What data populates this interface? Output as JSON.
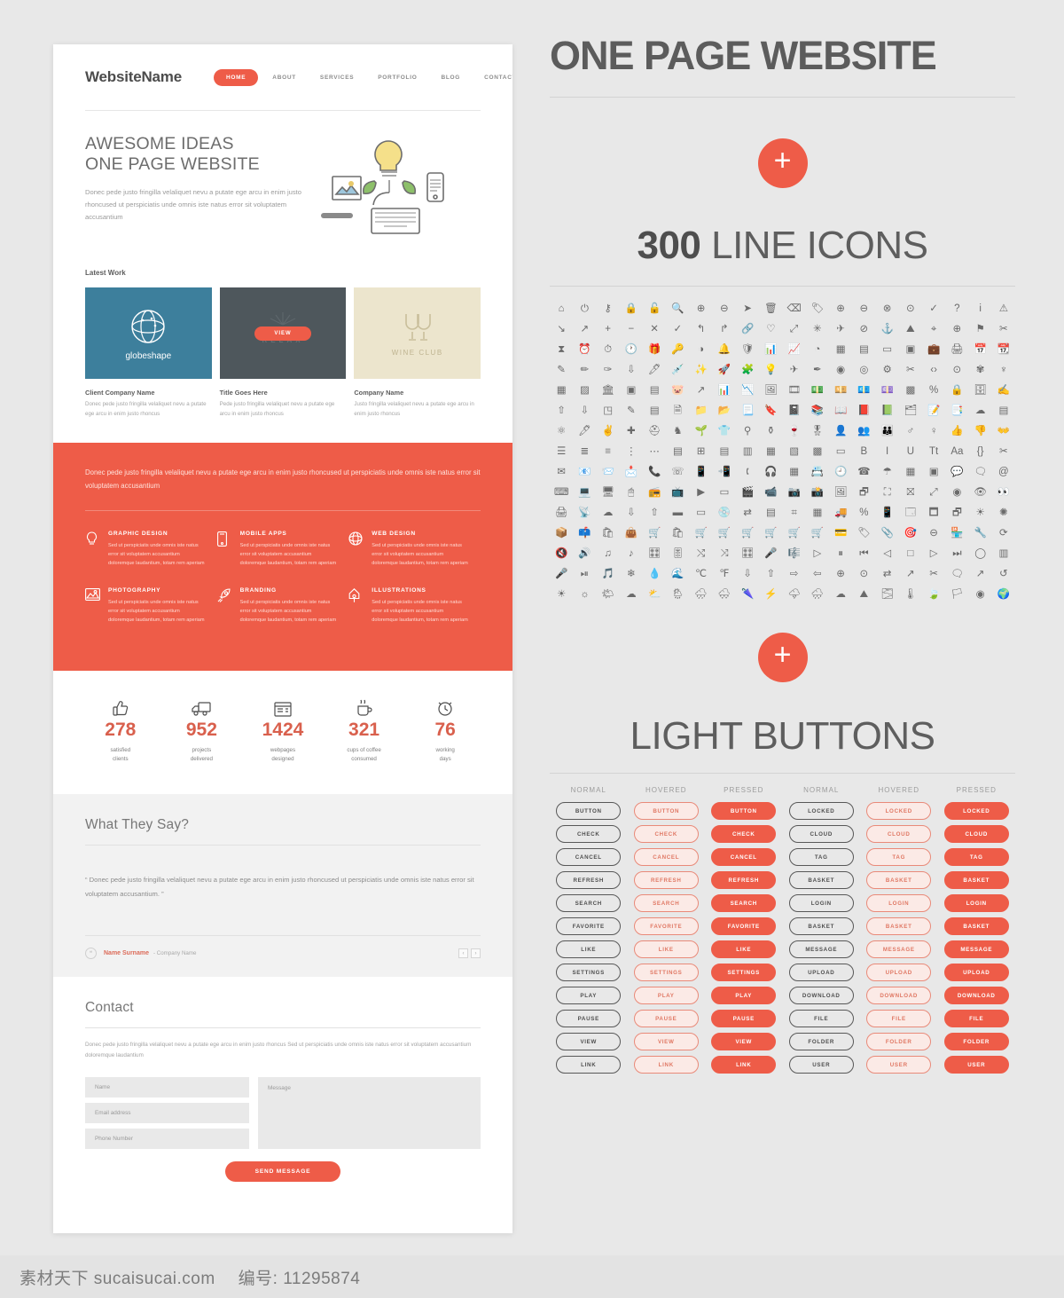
{
  "site": {
    "logo": "WebsiteName",
    "nav": [
      {
        "label": "HOME",
        "active": true
      },
      {
        "label": "ABOUT",
        "active": false
      },
      {
        "label": "SERVICES",
        "active": false
      },
      {
        "label": "PORTFOLIO",
        "active": false
      },
      {
        "label": "BLOG",
        "active": false
      },
      {
        "label": "CONTACT",
        "active": false
      }
    ],
    "hero": {
      "title_line1": "AWESOME IDEAS",
      "title_line2": "ONE PAGE WEBSITE",
      "paragraph": "Donec pede justo fringilla velaliquet nevu a putate ege arcu in enim justo rhoncused ut perspiciatis unde omnis iste natus error sit voluptatem accusantium"
    },
    "latest_work": {
      "label": "Latest Work",
      "items": [
        {
          "brand": "globeshape",
          "bg": "#3d7f9c",
          "title": "Client Company Name",
          "desc": "Donec pede justo fringilla velaliquet nevu a putate ege arcu in enim justo rhoncus"
        },
        {
          "brand": "RELAX",
          "button": "VIEW",
          "bg": "#4e575c",
          "title": "Title Goes Here",
          "desc": "Pede justo fringilla velaliquet nevu a putate ege arcu in enim justo rhoncus"
        },
        {
          "brand": "WINE CLUB",
          "bg": "#ece5cd",
          "title": "Company Name",
          "desc": "Justo fringilla velaliquet nevu a putate ege arcu in enim justo rhoncus"
        }
      ]
    },
    "services": {
      "intro": "Donec pede justo fringilla velaliquet nevu a putate ege arcu in enim justo rhoncused ut perspiciatis unde omnis iste natus error sit voluptatem accusantium",
      "items": [
        {
          "icon": "lightbulb-icon",
          "title": "GRAPHIC DESIGN",
          "desc": "Sed ut perspiciatis unde omnis iste natus error sit voluptatem accusantium doloremque laudantium, totam rem aperiam"
        },
        {
          "icon": "mobile-phone-icon",
          "title": "MOBILE APPS",
          "desc": "Sed ut perspiciatis unde omnis iste natus error sit voluptatem accusantium doloremque laudantium, totam rem aperiam"
        },
        {
          "icon": "globe-icon",
          "title": "WEB DESIGN",
          "desc": "Sed ut perspiciatis unde omnis iste natus error sit voluptatem accusantium doloremque laudantium, totam rem aperiam"
        },
        {
          "icon": "photo-icon",
          "title": "PHOTOGRAPHY",
          "desc": "Sed ut perspiciatis unde omnis iste natus error sit voluptatem accusantium doloremque laudantium, totam rem aperiam"
        },
        {
          "icon": "rocket-icon",
          "title": "BRANDING",
          "desc": "Sed ut perspiciatis unde omnis iste natus error sit voluptatem accusantium doloremque laudantium, totam rem aperiam"
        },
        {
          "icon": "pen-nib-icon",
          "title": "ILLUSTRATIONS",
          "desc": "Sed ut perspiciatis unde omnis iste natus error sit voluptatem accusantium doloremque laudantium, totam rem aperiam"
        }
      ]
    },
    "stats": [
      {
        "icon": "thumbs-up-icon",
        "value": "278",
        "label_line1": "satisfied",
        "label_line2": "clients"
      },
      {
        "icon": "delivery-truck-icon",
        "value": "952",
        "label_line1": "projects",
        "label_line2": "delivered"
      },
      {
        "icon": "browser-window-icon",
        "value": "1424",
        "label_line1": "webpages",
        "label_line2": "designed"
      },
      {
        "icon": "coffee-cup-icon",
        "value": "321",
        "label_line1": "cups of coffee",
        "label_line2": "consumed"
      },
      {
        "icon": "alarm-clock-icon",
        "value": "76",
        "label_line1": "working",
        "label_line2": "days"
      }
    ],
    "testimonial": {
      "heading": "What They Say?",
      "quote": "“ Donec pede justo fringilla velaliquet nevu a putate ege arcu in enim justo rhoncused ut perspiciatis unde omnis iste natus error sit voluptatem accusantium. ”",
      "author": "Name Surname",
      "company": "- Company Name",
      "prev": "‹",
      "next": "›"
    },
    "contact": {
      "heading": "Contact",
      "paragraph": "Donec pede justo fringilla velaliquet nevu a putate ege arcu in enim justo rhoncus Sed ut perspiciatis unde omnis iste natus error sit voluptatem accusantium doloremque laudantium",
      "name_placeholder": "Name",
      "email_placeholder": "Email address",
      "phone_placeholder": "Phone Number",
      "message_placeholder": "Message",
      "send_label": "SEND MESSAGE"
    }
  },
  "right": {
    "title": "ONE PAGE WEBSITE",
    "plus_label": "+",
    "icons_count": "300",
    "icons_title": " LINE ICONS",
    "buttons_title": "LIGHT BUTTONS",
    "state_headers": [
      "NORMAL",
      "HOVERED",
      "PRESSED",
      "NORMAL",
      "HOVERED",
      "PRESSED"
    ],
    "buttons_left": [
      "BUTTON",
      "CHECK",
      "CANCEL",
      "REFRESH",
      "SEARCH",
      "FAVORITE",
      "LIKE",
      "SETTINGS",
      "PLAY",
      "PAUSE",
      "VIEW",
      "LINK"
    ],
    "buttons_right": [
      "LOCKED",
      "CLOUD",
      "TAG",
      "BASKET",
      "LOGIN",
      "BASKET",
      "MESSAGE",
      "UPLOAD",
      "DOWNLOAD",
      "FILE",
      "FOLDER",
      "USER"
    ],
    "icon_glyphs": [
      "⌂",
      "⏻",
      "⚷",
      "🔒",
      "🔓",
      "🔍",
      "⊕",
      "⊖",
      "➤",
      "🗑",
      "⌫",
      "🏷",
      "⊕",
      "⊖",
      "⊗",
      "⊙",
      "✓",
      "?",
      "i",
      "⚠",
      "↘",
      "↗",
      "+",
      "−",
      "✕",
      "✓",
      "↰",
      "↱",
      "🔗",
      "♡",
      "⤢",
      "✳",
      "✈",
      "⊘",
      "⚓",
      "⛰",
      "⌖",
      "⊕",
      "⚑",
      "✂",
      "⧗",
      "⏰",
      "⏱",
      "🕐",
      "🎁",
      "🔑",
      "◑",
      "🔔",
      "🛡",
      "📊",
      "📈",
      "◔",
      "▦",
      "▤",
      "▭",
      "▣",
      "💼",
      "🖨",
      "📅",
      "📆",
      "✎",
      "✏",
      "✑",
      "⇩",
      "🖊",
      "💉",
      "✨",
      "🚀",
      "🧩",
      "💡",
      "✈",
      "✒",
      "◉",
      "◎",
      "⚙",
      "✂",
      "‹›",
      "⊙",
      "✾",
      "♆",
      "▦",
      "▨",
      "🏛",
      "▣",
      "▤",
      "🐷",
      "↗",
      "📊",
      "📉",
      "🖼",
      "🎞",
      "💵",
      "💴",
      "💶",
      "💷",
      "▩",
      "%",
      "🔒",
      "🗄",
      "✍",
      "⇧",
      "⇩",
      "◳",
      "✎",
      "▤",
      "🗎",
      "📁",
      "📂",
      "📃",
      "🔖",
      "📓",
      "📚",
      "📖",
      "📕",
      "📗",
      "🗂",
      "📝",
      "📑",
      "☁",
      "▤",
      "⚛",
      "🖊",
      "✌",
      "✚",
      "⛑",
      "♞",
      "🌱",
      "👕",
      "⚲",
      "⚱",
      "🍷",
      "🎖",
      "👤",
      "👥",
      "👪",
      "♂",
      "♀",
      "👍",
      "👎",
      "👐",
      "☰",
      "≣",
      "≡",
      "⋮",
      "⋯",
      "▤",
      "⊞",
      "▤",
      "▥",
      "▦",
      "▧",
      "▩",
      "▭",
      "B",
      "I",
      "U",
      "Tt",
      "Aa",
      "{}",
      "✂",
      "✉",
      "📧",
      "📨",
      "📩",
      "📞",
      "☏",
      "📱",
      "📲",
      "🕻",
      "🎧",
      "▦",
      "📇",
      "🕘",
      "☎",
      "☂",
      "▦",
      "▣",
      "💬",
      "🗨",
      "@",
      "⌨",
      "💻",
      "🖥",
      "🖱",
      "📻",
      "📺",
      "▶",
      "▭",
      "🎬",
      "📹",
      "📷",
      "📸",
      "🖼",
      "🗗",
      "⛶",
      "⛝",
      "⤢",
      "◉",
      "👁",
      "👀",
      "🖨",
      "📡",
      "☁",
      "⇩",
      "⇧",
      "▬",
      "▭",
      "💿",
      "⇄",
      "▤",
      "⌗",
      "▦",
      "🚚",
      "%",
      "📱",
      "🗔",
      "🗖",
      "🗗",
      "☀",
      "✺",
      "📦",
      "📫",
      "🛍",
      "👜",
      "🛒",
      "🛍",
      "🛒",
      "🛒",
      "🛒",
      "🛒",
      "🛒",
      "🛒",
      "💳",
      "🏷",
      "📎",
      "🎯",
      "⊖",
      "🏪",
      "🔧",
      "⟳",
      "🔇",
      "🔊",
      "♫",
      "♪",
      "🎛",
      "🎚",
      "⤭",
      "⤨",
      "🎛",
      "🎤",
      "🎼",
      "▷",
      "⏸",
      "⏮",
      "◁",
      "□",
      "▷",
      "⏭",
      "◯",
      "▥",
      "🎤",
      "⏯",
      "🎵",
      "❄",
      "💧",
      "🌊",
      "℃",
      "℉",
      "⇩",
      "⇧",
      "⇨",
      "⇦",
      "⊕",
      "⊙",
      "⇄",
      "↗",
      "✂",
      "🗨",
      "↗",
      "↺",
      "☀",
      "☼",
      "🌤",
      "☁",
      "⛅",
      "🌦",
      "🌧",
      "🌨",
      "🌂",
      "⚡",
      "🌩",
      "🌧",
      "☁",
      "⛰",
      "🌫",
      "🌡",
      "🍃",
      "🏳",
      "◉",
      "🌍"
    ]
  },
  "watermark": {
    "text": "素材天下 sucaisucai.com",
    "number": "编号: 11295874"
  }
}
